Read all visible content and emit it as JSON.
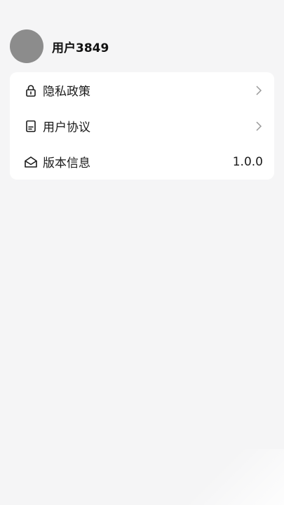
{
  "profile": {
    "username": "用户3849",
    "avatar_color": "#8c8c8c"
  },
  "menu": {
    "items": [
      {
        "label": "隐私政策",
        "icon": "lock-icon",
        "trailing": "chevron-right-icon"
      },
      {
        "label": "用户协议",
        "icon": "document-icon",
        "trailing": "chevron-right-icon"
      },
      {
        "label": "版本信息",
        "icon": "mail-open-icon",
        "value": "1.0.0"
      }
    ]
  },
  "colors": {
    "background": "#f5f5f6",
    "card": "#ffffff",
    "text": "#1a1a1a",
    "chevron": "#9a9a9a"
  }
}
